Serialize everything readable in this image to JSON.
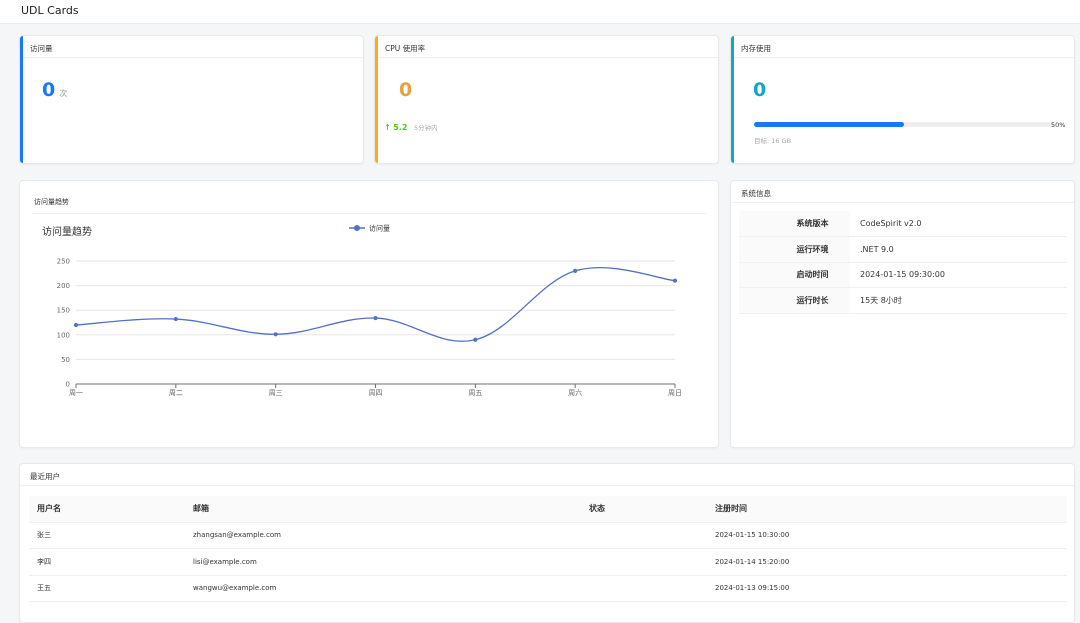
{
  "page": {
    "title": "UDL Cards"
  },
  "cards": {
    "visits": {
      "title": "访问量",
      "value": "0",
      "unit": "次",
      "accent": "#1677ff"
    },
    "cpu": {
      "title": "CPU 使用率",
      "value": "0",
      "trend_value": "5.2",
      "trend_label": "5分钟内",
      "accent": "#faad14"
    },
    "memory": {
      "title": "内存使用",
      "value": "0",
      "percent": 50,
      "percent_label": "50%",
      "target_label": "目标: 16 GB",
      "accent": "#13a8c2"
    }
  },
  "trend_card": {
    "header": "访问量趋势",
    "chart_title": "访问量趋势"
  },
  "chart_data": {
    "type": "line",
    "title": "访问量趋势",
    "categories": [
      "周一",
      "周二",
      "周三",
      "周四",
      "周五",
      "周六",
      "周日"
    ],
    "series": [
      {
        "name": "访问量",
        "values": [
          120,
          132,
          101,
          134,
          90,
          230,
          210
        ],
        "color": "#5470c6"
      }
    ],
    "y_ticks": [
      "0",
      "50",
      "100",
      "150",
      "200",
      "250"
    ],
    "ylim": [
      0,
      250
    ],
    "grid": true,
    "legend": "top-center",
    "smooth": true
  },
  "system_info": {
    "header": "系统信息",
    "rows": [
      {
        "key": "系统版本",
        "value": "CodeSpirit v2.0"
      },
      {
        "key": "运行环境",
        "value": ".NET 9.0"
      },
      {
        "key": "启动时间",
        "value": "2024-01-15 09:30:00"
      },
      {
        "key": "运行时长",
        "value": "15天 8小时"
      }
    ]
  },
  "users": {
    "header": "最近用户",
    "columns": [
      "用户名",
      "邮箱",
      "状态",
      "注册时间"
    ],
    "rows": [
      {
        "name": "张三",
        "email": "zhangsan@example.com",
        "status": "",
        "time": "2024-01-15 10:30:00"
      },
      {
        "name": "李四",
        "email": "lisi@example.com",
        "status": "",
        "time": "2024-01-14 15:20:00"
      },
      {
        "name": "王五",
        "email": "wangwu@example.com",
        "status": "",
        "time": "2024-01-13 09:15:00"
      }
    ]
  }
}
